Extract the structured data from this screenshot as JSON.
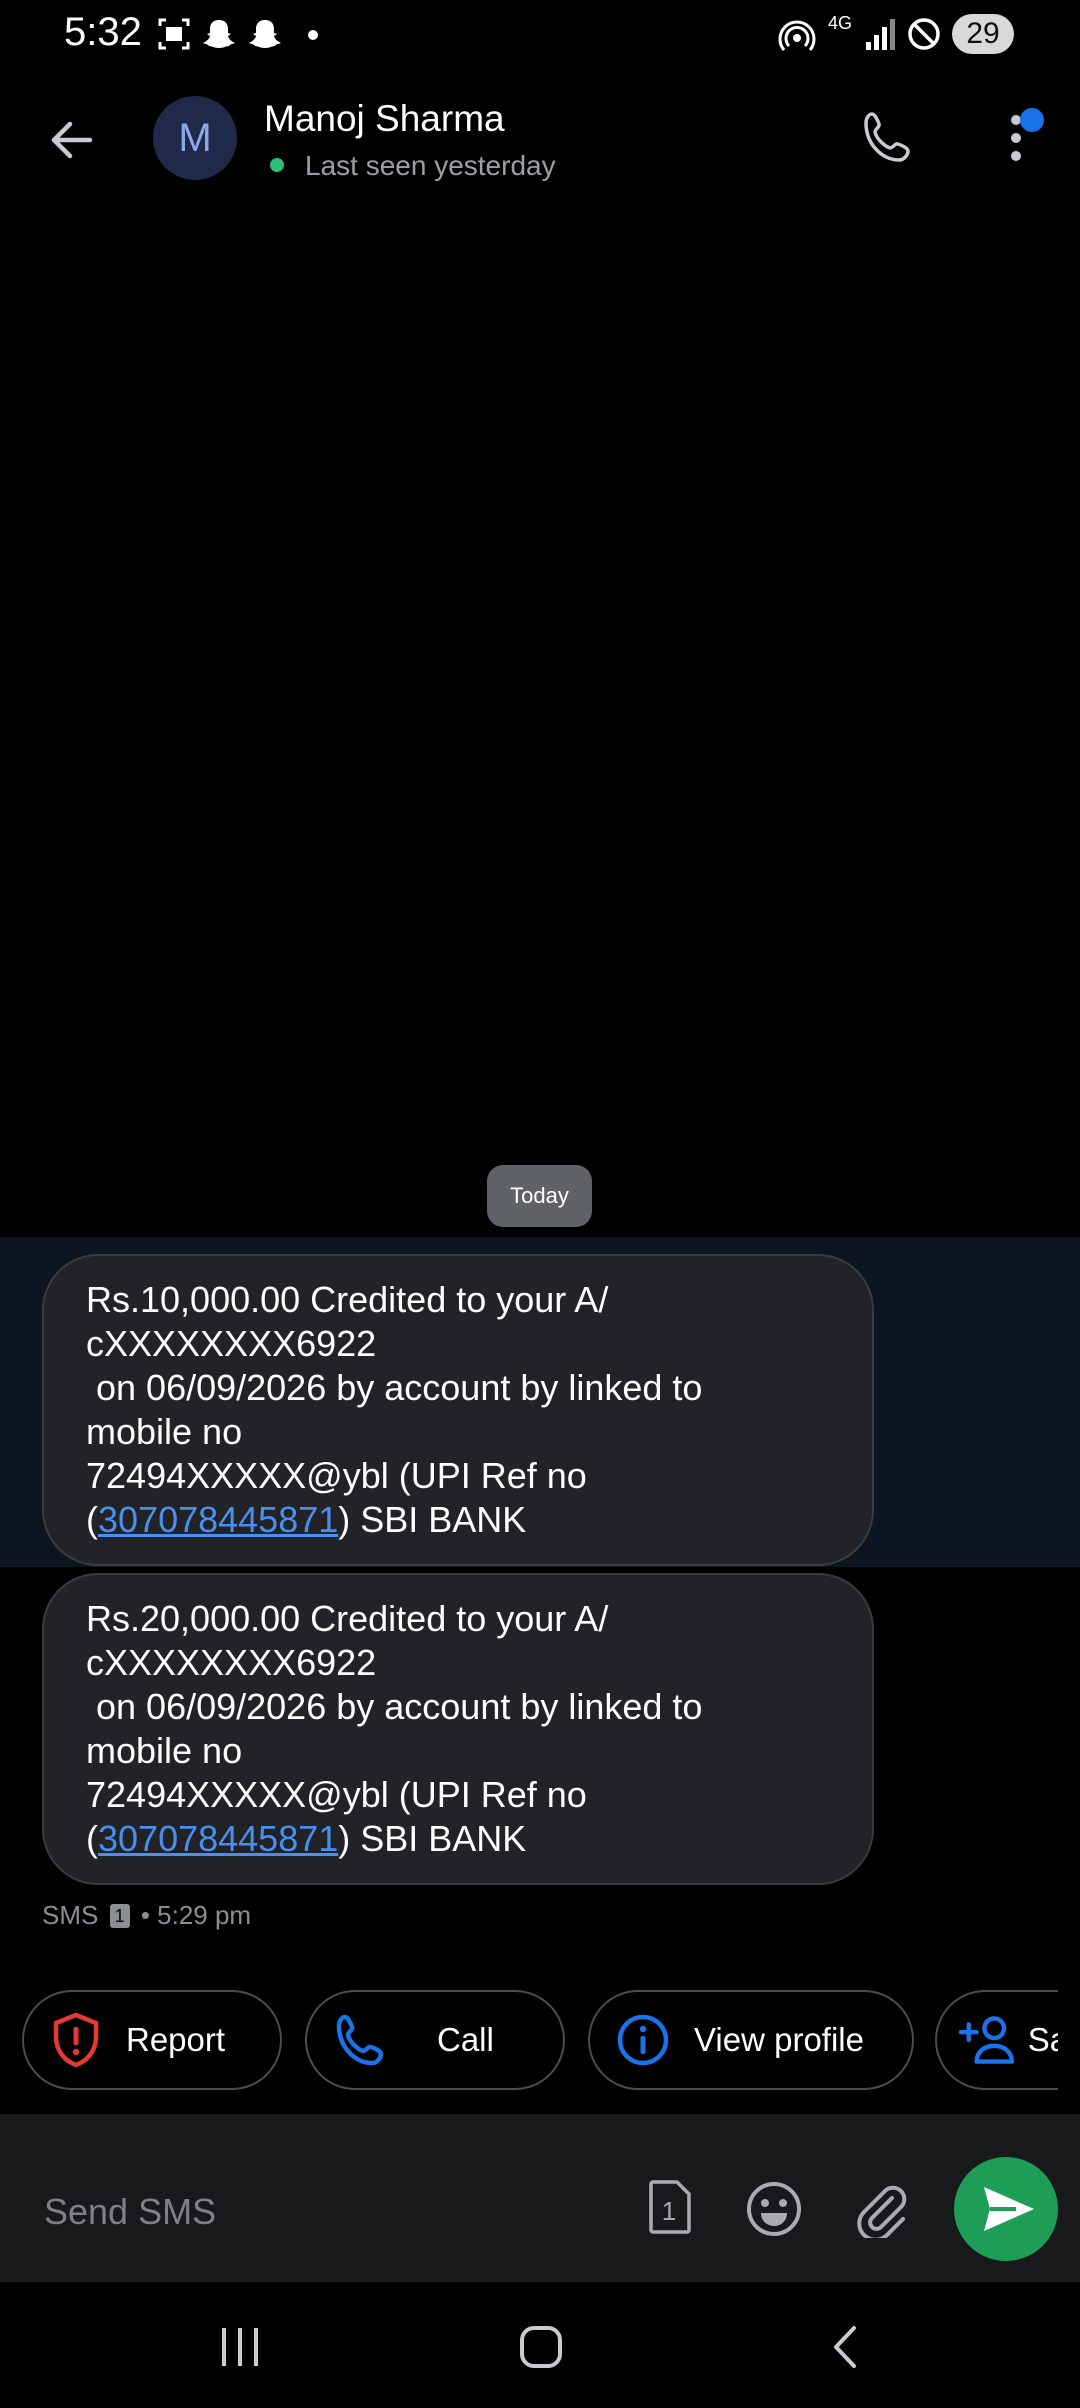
{
  "status_bar": {
    "time": "5:32",
    "battery": "29",
    "network": "4G"
  },
  "header": {
    "avatar_letter": "M",
    "contact_name": "Manoj Sharma",
    "last_seen": "Last seen yesterday"
  },
  "conversation": {
    "date_chip": "Today",
    "messages": [
      {
        "lines": [
          "Rs.10,000.00 Credited to your A/",
          "cXXXXXXXX6922",
          " on 06/09/2026 by account by linked to",
          "mobile no",
          "72494XXXXX@ybl (UPI Ref no"
        ],
        "last_prefix": "(",
        "ref_link": "307078445871",
        "last_suffix": ") SBI BANK"
      },
      {
        "lines": [
          "Rs.20,000.00 Credited to your A/",
          "cXXXXXXXX6922",
          " on 06/09/2026 by account by linked to",
          "mobile no",
          "72494XXXXX@ybl (UPI Ref no"
        ],
        "last_prefix": "(",
        "ref_link": "307078445871",
        "last_suffix": ") SBI BANK"
      }
    ],
    "meta": {
      "type": "SMS",
      "sim": "1",
      "time": "• 5:29 pm"
    }
  },
  "actions": {
    "report": "Report",
    "call": "Call",
    "view_profile": "View profile",
    "save": "Save"
  },
  "composer": {
    "placeholder": "Send SMS",
    "sim": "1"
  },
  "colors": {
    "accent": "#1a73e8",
    "send": "#1e9d57",
    "report": "#e53935",
    "link": "#4a8ef0"
  }
}
